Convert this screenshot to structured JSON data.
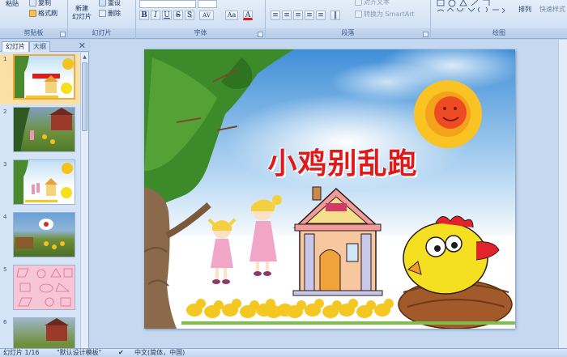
{
  "ribbon": {
    "clipboard": {
      "paste": "粘贴",
      "copy": "复制",
      "format_painter": "格式刷",
      "label": "剪贴板"
    },
    "slides": {
      "new_slide_line1": "新建",
      "new_slide_line2": "幻灯片",
      "reset": "重设",
      "delete": "删除",
      "label": "幻灯片"
    },
    "font": {
      "bold": "B",
      "italic": "I",
      "underline": "U",
      "strike": "S",
      "shadow": "S",
      "spacing": "AV",
      "case": "Aa",
      "color": "A",
      "label": "字体"
    },
    "paragraph": {
      "align_text": "对齐文本",
      "smartart": "转换为 SmartArt",
      "label": "段落"
    },
    "drawing": {
      "arrange": "排列",
      "quick_styles": "快速样式",
      "label": "绘图"
    }
  },
  "pane": {
    "tab_slides": "幻灯片",
    "tab_outline": "大纲",
    "close": "✕",
    "slides": [
      {
        "num": "1",
        "selected": true
      },
      {
        "num": "2",
        "selected": false
      },
      {
        "num": "3",
        "selected": false
      },
      {
        "num": "4",
        "selected": false
      },
      {
        "num": "5",
        "selected": false
      },
      {
        "num": "6",
        "selected": false
      }
    ]
  },
  "slide": {
    "title": "小鸡别乱跑"
  },
  "status": {
    "slide_count": "幻灯片 1/16",
    "theme": "\"默认设计模板\"",
    "language": "中文(简体，中国)"
  }
}
